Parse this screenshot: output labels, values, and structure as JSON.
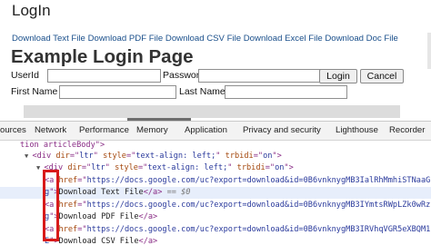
{
  "page": {
    "title": "LogIn",
    "download_links": [
      "Download Text File",
      "Download PDF File",
      "Download CSV File",
      "Download Excel File",
      "Download Doc File"
    ],
    "heading": "Example Login Page",
    "userid_label": "UserId",
    "password_label": "Password",
    "firstname_label": "First Name",
    "lastname_label": "Last Name",
    "login_button": "Login",
    "cancel_button": "Cancel"
  },
  "devtools": {
    "tabs": [
      "ources",
      "Network",
      "Performance",
      "Memory",
      "Application",
      "Privacy and security",
      "Lighthouse",
      "Recorder"
    ],
    "lines": [
      {
        "parts": [
          {
            "c": "tag",
            "t": "tion articleBody\">"
          }
        ]
      },
      {
        "parts": [
          {
            "c": "arrow",
            "t": "▼ "
          },
          {
            "c": "tag",
            "t": "<div "
          },
          {
            "c": "attr",
            "t": "dir"
          },
          {
            "c": "tag",
            "t": "=\""
          },
          {
            "c": "val",
            "t": "ltr"
          },
          {
            "c": "tag",
            "t": "\" "
          },
          {
            "c": "attr",
            "t": "style"
          },
          {
            "c": "tag",
            "t": "=\""
          },
          {
            "c": "val",
            "t": "text-align: left;"
          },
          {
            "c": "tag",
            "t": "\" "
          },
          {
            "c": "attr",
            "t": "trbidi"
          },
          {
            "c": "tag",
            "t": "=\""
          },
          {
            "c": "val",
            "t": "on"
          },
          {
            "c": "tag",
            "t": "\">"
          }
        ]
      },
      {
        "parts": [
          {
            "c": "arrow",
            "t": "▼ "
          },
          {
            "c": "tag",
            "t": "<div "
          },
          {
            "c": "attr",
            "t": "dir"
          },
          {
            "c": "tag",
            "t": "=\""
          },
          {
            "c": "val",
            "t": "ltr"
          },
          {
            "c": "tag",
            "t": "\" "
          },
          {
            "c": "attr",
            "t": "style"
          },
          {
            "c": "tag",
            "t": "=\""
          },
          {
            "c": "val",
            "t": "text-align: left;"
          },
          {
            "c": "tag",
            "t": "\" "
          },
          {
            "c": "attr",
            "t": "trbidi"
          },
          {
            "c": "tag",
            "t": "=\""
          },
          {
            "c": "val",
            "t": "on"
          },
          {
            "c": "tag",
            "t": "\">"
          }
        ]
      },
      {
        "parts": [
          {
            "c": "tag",
            "t": "<a "
          },
          {
            "c": "attr",
            "t": "href"
          },
          {
            "c": "tag",
            "t": "=\""
          },
          {
            "c": "val",
            "t": "https://docs.google.com/uc?export=download&id=0B6vnknygMB3IalRhMmhiSTNaaG"
          }
        ]
      },
      {
        "sel": true,
        "parts": [
          {
            "c": "val",
            "t": "g"
          },
          {
            "c": "tag",
            "t": "\">"
          },
          {
            "c": "plain",
            "t": "Download Text File"
          },
          {
            "c": "tag",
            "t": "</a>"
          },
          {
            "c": "cmt",
            "t": " == $0"
          }
        ]
      },
      {
        "parts": [
          {
            "c": "tag",
            "t": "<a "
          },
          {
            "c": "attr",
            "t": "href"
          },
          {
            "c": "tag",
            "t": "=\""
          },
          {
            "c": "val",
            "t": "https://docs.google.com/uc?export=download&id=0B6vnknygMB3IYmtsRWpLZk0wRz"
          }
        ]
      },
      {
        "parts": [
          {
            "c": "val",
            "t": "g"
          },
          {
            "c": "tag",
            "t": "\">"
          },
          {
            "c": "plain",
            "t": "Download PDF File"
          },
          {
            "c": "tag",
            "t": "</a>"
          }
        ]
      },
      {
        "parts": [
          {
            "c": "tag",
            "t": "<a "
          },
          {
            "c": "attr",
            "t": "href"
          },
          {
            "c": "tag",
            "t": "=\""
          },
          {
            "c": "val",
            "t": "https://docs.google.com/uc?export=download&id=0B6vnknygMB3IRVhqVGR5eXBQM1"
          }
        ]
      },
      {
        "parts": [
          {
            "c": "val",
            "t": "E"
          },
          {
            "c": "tag",
            "t": "\">"
          },
          {
            "c": "plain",
            "t": "Download CSV File"
          },
          {
            "c": "tag",
            "t": "</a>"
          }
        ]
      }
    ]
  }
}
